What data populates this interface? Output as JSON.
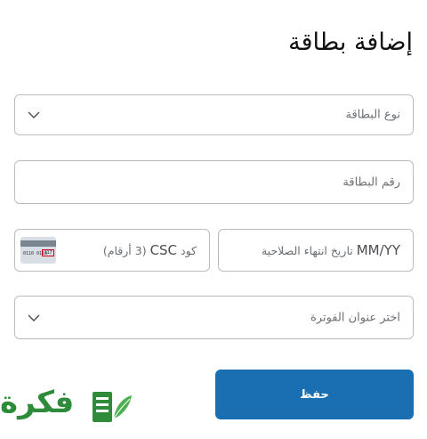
{
  "page": {
    "title": "إضافة بطاقة"
  },
  "fields": {
    "card_type": {
      "placeholder": "نوع البطاقة"
    },
    "card_number": {
      "placeholder": "رقم البطاقة"
    },
    "expiry": {
      "format": "MM/YY",
      "placeholder": "تاريخ انتهاء الصلاحية"
    },
    "csc": {
      "code": "CSC",
      "placeholder_before": "كود",
      "placeholder_after": "(3 أرقام)"
    },
    "billing_address": {
      "placeholder": "اختر عنوان الفوترة"
    }
  },
  "card_icon": {
    "digits": "0110 0110",
    "cvv": "117"
  },
  "actions": {
    "save_label": "حفظ"
  },
  "logo": {
    "wordmark": "فكرة"
  },
  "colors": {
    "primary": "#1a6fb3",
    "border": "#b9bdc2",
    "logo_green": "#2e8b3a"
  },
  "icons": {
    "dropdown": "chevron-down-icon",
    "card": "credit-card-cvv-icon",
    "logo": "book-leaf-icon"
  }
}
